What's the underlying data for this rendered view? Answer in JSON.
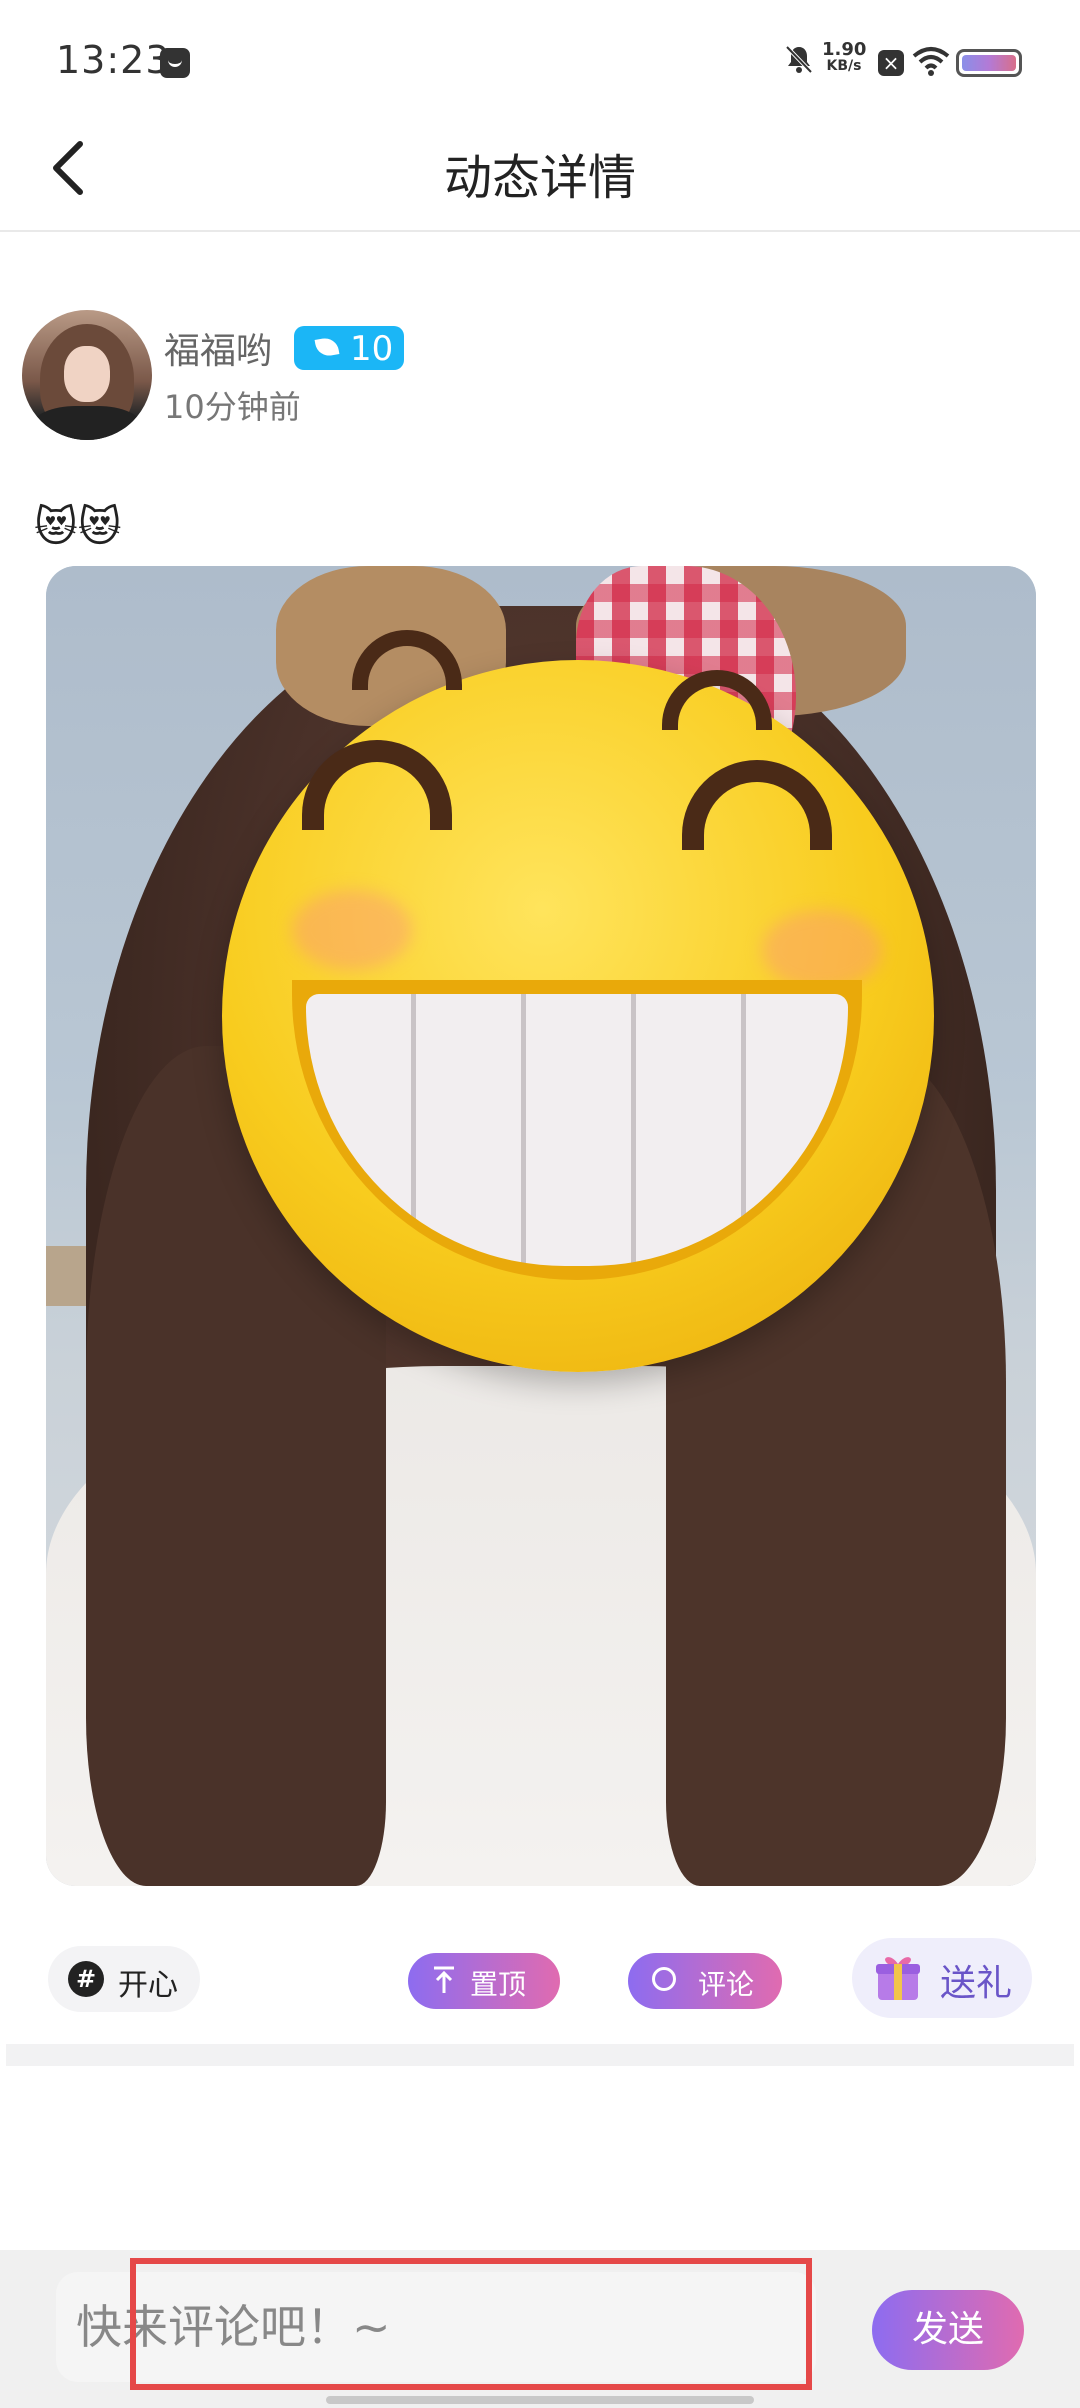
{
  "status_bar": {
    "time": "13:23",
    "net_speed_value": "1.90",
    "net_speed_unit": "KB/s",
    "battery_colors": [
      "#8a8fe8",
      "#d86f8a"
    ]
  },
  "header": {
    "title": "动态详情",
    "back_icon": "chevron-left-icon"
  },
  "post": {
    "username": "福福哟",
    "level": "10",
    "level_badge_color": "#1bb6f6",
    "time_ago": "10分钟前",
    "text": "😻😻",
    "photo_icon": "photo-smiley-emoji-overlay"
  },
  "actions": {
    "tag_label": "开心",
    "pin_label": "置顶",
    "comment_label": "评论",
    "gift_label": "送礼"
  },
  "comment_bar": {
    "placeholder": "快来评论吧！~",
    "send_label": "发送",
    "accent_gradient": [
      "#8d6cf0",
      "#e06bb0"
    ]
  }
}
